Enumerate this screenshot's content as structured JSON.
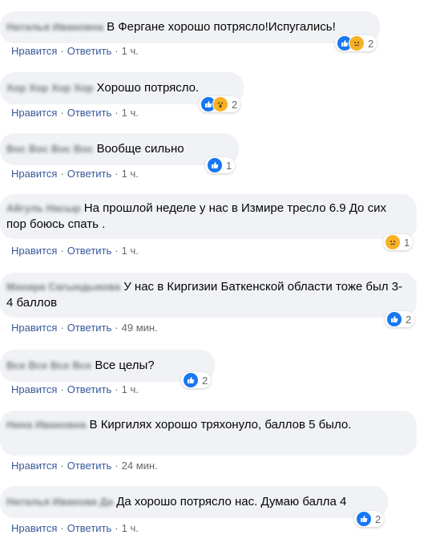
{
  "actions": {
    "like": "Нравится",
    "reply": "Ответить",
    "separator": "·"
  },
  "comments": [
    {
      "author": "Наталья Ивановна",
      "text": "В Фергане хорошо потрясло!Испугались!",
      "time": "1 ч.",
      "reaction_count": "2",
      "reactions": [
        "like-icon",
        "sad-icon"
      ]
    },
    {
      "author": "Хор Хор Хор Хор",
      "text": "Хорошо потрясло.",
      "time": "1 ч.",
      "reaction_count": "2",
      "reactions": [
        "like-icon",
        "wow-icon"
      ]
    },
    {
      "author": "Вос Вос Вос Вос",
      "text": "Вообще сильно",
      "time": "1 ч.",
      "reaction_count": "1",
      "reactions": [
        "like-icon"
      ]
    },
    {
      "author": "Айгуль Насыр",
      "text": "На прошлой неделе у нас в Измире тресло 6.9 До сих пор боюсь спать .",
      "time": "1 ч.",
      "reaction_count": "1",
      "reactions": [
        "sad-icon"
      ]
    },
    {
      "author": "Махира Сагындыкова",
      "text": "У нас в Киргизии Баткенской области тоже был 3-4 баллов",
      "time": "49 мин.",
      "reaction_count": "2",
      "reactions": [
        "like-icon"
      ]
    },
    {
      "author": "Все Все Все Все",
      "text": "Все целы?",
      "time": "1 ч.",
      "reaction_count": "2",
      "reactions": [
        "like-icon"
      ]
    },
    {
      "author": "Нина Ивановна",
      "text": "В Киргилях хорошо тряхонуло, баллов 5 было.",
      "time": "24 мин.",
      "reaction_count": "",
      "reactions": []
    },
    {
      "author": "Наталья Иванова Да",
      "text": "Да хорошо потрясло нас. Думаю балла 4",
      "time": "1 ч.",
      "reaction_count": "2",
      "reactions": [
        "like-icon"
      ]
    }
  ],
  "colors": {
    "like": "#1877f2",
    "emoji": "#f7b125",
    "bubble": "#f0f2f5",
    "link": "#385898"
  }
}
